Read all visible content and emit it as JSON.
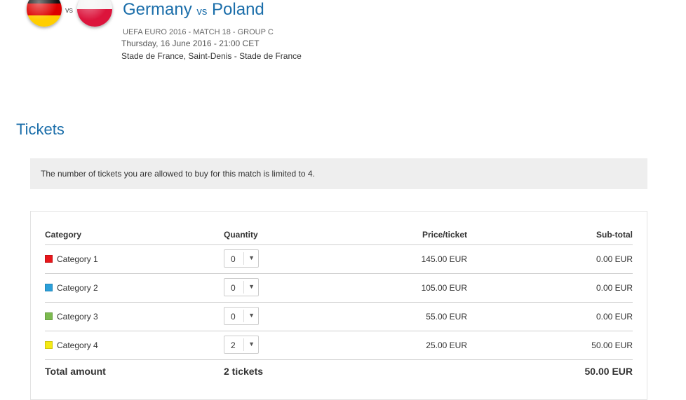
{
  "match": {
    "home_team": "Germany",
    "vs_label": "vs",
    "away_team": "Poland",
    "competition_line": "UEFA EURO 2016 - MATCH 18 - GROUP C",
    "datetime_line": "Thursday, 16 June 2016 - 21:00 CET",
    "venue_line": "Stade de France, Saint-Denis - Stade de France",
    "flag_icons": [
      "germany-flag-icon",
      "poland-flag-icon"
    ]
  },
  "tickets": {
    "section_title": "Tickets",
    "notice": "The number of tickets you are allowed to buy for this match is limited to 4.",
    "columns": [
      "Category",
      "Quantity",
      "Price/ticket",
      "Sub-total"
    ],
    "rows": [
      {
        "category": "Category 1",
        "color": "#e8161b",
        "quantity": "0",
        "price": "145.00 EUR",
        "subtotal": "0.00 EUR"
      },
      {
        "category": "Category 2",
        "color": "#2b9fd9",
        "quantity": "0",
        "price": "105.00 EUR",
        "subtotal": "0.00 EUR"
      },
      {
        "category": "Category 3",
        "color": "#7cba4f",
        "quantity": "0",
        "price": "55.00 EUR",
        "subtotal": "0.00 EUR"
      },
      {
        "category": "Category 4",
        "color": "#f5ea14",
        "quantity": "2",
        "price": "25.00 EUR",
        "subtotal": "50.00 EUR"
      }
    ],
    "total": {
      "label": "Total amount",
      "tickets": "2 tickets",
      "amount": "50.00 EUR"
    }
  },
  "colors": {
    "accent": "#1b6eaa",
    "notice_bg": "#eeeeee"
  }
}
